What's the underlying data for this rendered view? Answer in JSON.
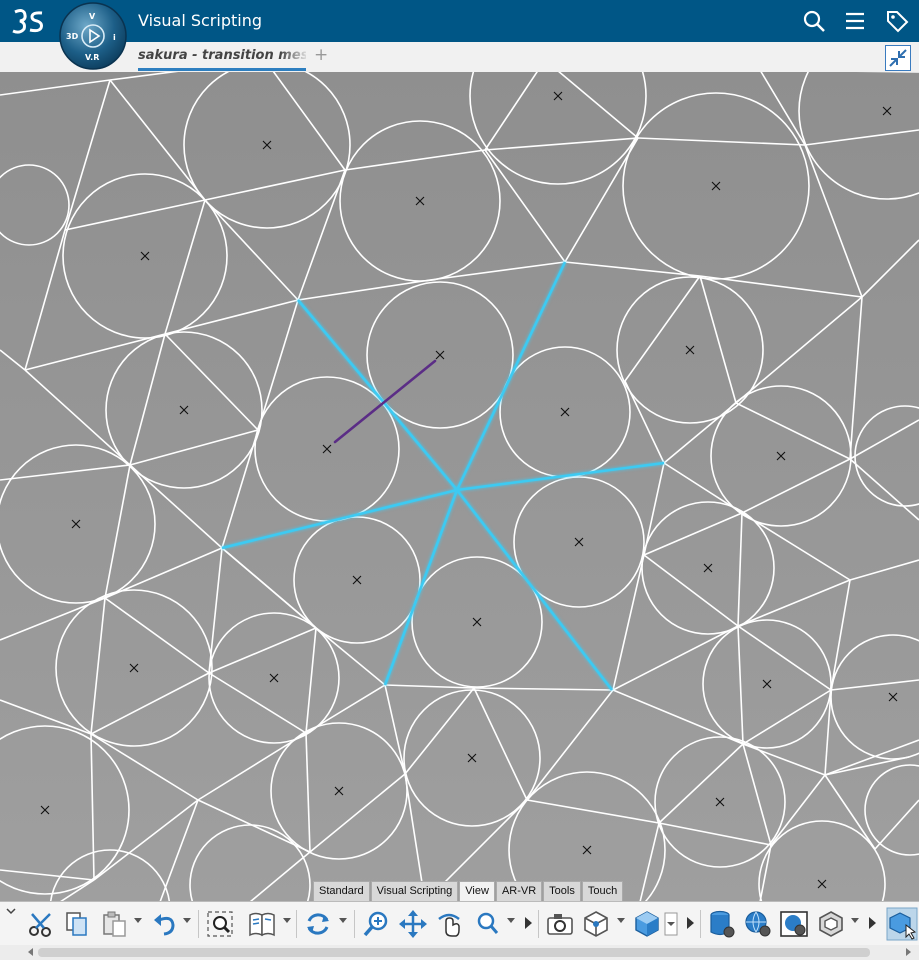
{
  "app": {
    "title": "Visual Scripting",
    "compass": {
      "label_3d": "3D",
      "label_vr": "V.R",
      "label_v": "V",
      "label_i": "i"
    },
    "tab_title": "sakura - transition mesh to circles",
    "add_tab_symbol": "+"
  },
  "toolbar_tabs": [
    "Standard",
    "Visual Scripting",
    "View",
    "AR-VR",
    "Tools",
    "Touch"
  ],
  "active_toolbar_tab": "View",
  "tools": [
    "scissors-icon",
    "copy-icon",
    "paste-icon",
    "undo-icon",
    "fit-all-icon",
    "book-icon",
    "rotate-icon",
    "zoom-icon",
    "pan-icon",
    "orbit-icon",
    "search-zoom-icon",
    "camera-icon",
    "view-cube-icon",
    "shaded-cube-icon",
    "database-icon",
    "settings-sphere-icon",
    "globe-display-icon",
    "hexagon-icon",
    "cube-select-icon"
  ],
  "colors": {
    "header_bg": "#005686",
    "canvas_bg": "#9a9a9a",
    "mesh_line": "#ffffff",
    "selected_edge": "#3ccaf2",
    "direction_line": "#5b2d86",
    "tab_underline": "#2e7fc0"
  }
}
